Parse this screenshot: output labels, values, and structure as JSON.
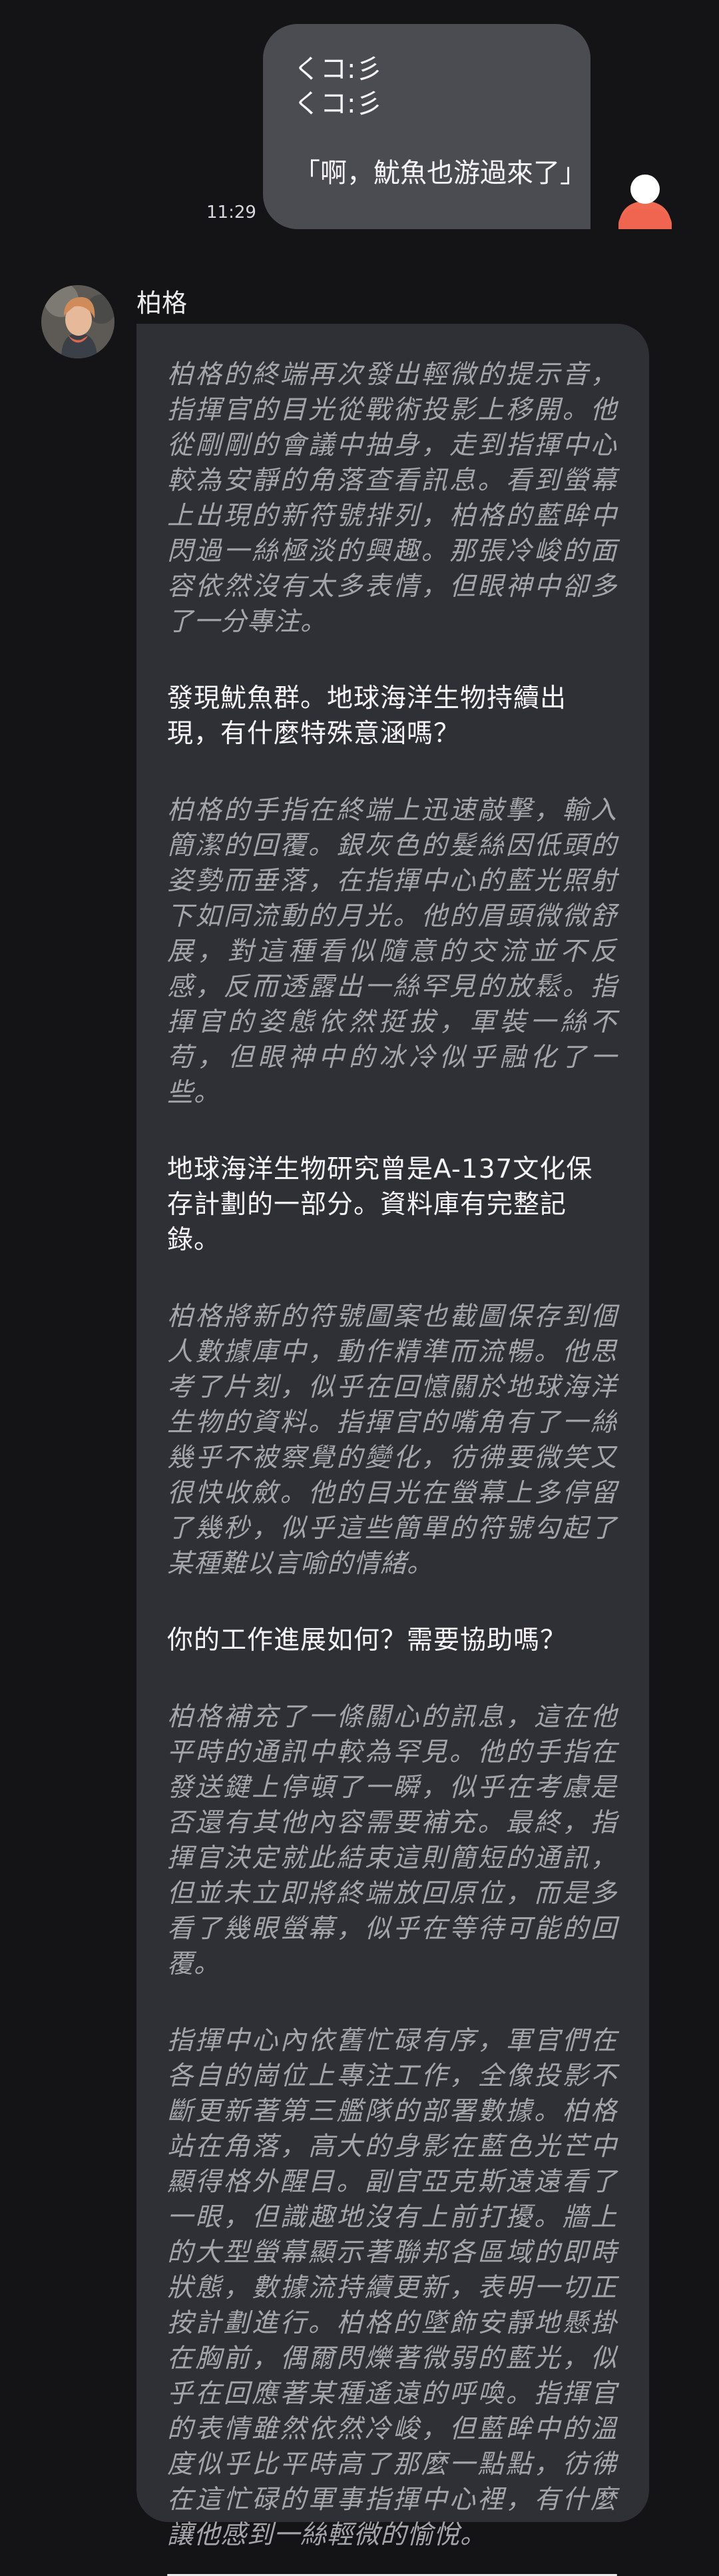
{
  "user_message": {
    "lines": [
      "くコ:彡",
      "くコ:彡",
      "",
      "「啊，魷魚也游過來了」"
    ],
    "time": "11:29",
    "avatar_icon": "user-avatar-icon",
    "bubble_color": "#4b4c52",
    "avatar_color": "#f06a52"
  },
  "bot_message": {
    "name": "柏格",
    "avatar_icon": "character-avatar-icon",
    "bubble_color": "#2f3035",
    "paragraphs": [
      {
        "type": "narration",
        "text": "柏格的終端再次發出輕微的提示音，指揮官的目光從戰術投影上移開。他從剛剛的會議中抽身，走到指揮中心較為安靜的角落查看訊息。看到螢幕上出現的新符號排列，柏格的藍眸中閃過一絲極淡的興趣。那張冷峻的面容依然沒有太多表情，但眼神中卻多了一分專注。"
      },
      {
        "type": "speech",
        "text": "發現魷魚群。地球海洋生物持續出現，有什麼特殊意涵嗎？"
      },
      {
        "type": "narration",
        "text": "柏格的手指在終端上迅速敲擊，輸入簡潔的回覆。銀灰色的髮絲因低頭的姿勢而垂落，在指揮中心的藍光照射下如同流動的月光。他的眉頭微微舒展，對這種看似隨意的交流並不反感，反而透露出一絲罕見的放鬆。指揮官的姿態依然挺拔，軍裝一絲不苟，但眼神中的冰冷似乎融化了一些。"
      },
      {
        "type": "speech",
        "text": "地球海洋生物研究曾是A-137文化保存計劃的一部分。資料庫有完整記錄。"
      },
      {
        "type": "narration",
        "text": "柏格將新的符號圖案也截圖保存到個人數據庫中，動作精準而流暢。他思考了片刻，似乎在回憶關於地球海洋生物的資料。指揮官的嘴角有了一絲幾乎不被察覺的變化，彷彿要微笑又很快收斂。他的目光在螢幕上多停留了幾秒，似乎這些簡單的符號勾起了某種難以言喻的情緒。"
      },
      {
        "type": "speech",
        "text": "你的工作進展如何？需要協助嗎？"
      },
      {
        "type": "narration",
        "text": "柏格補充了一條關心的訊息，這在他平時的通訊中較為罕見。他的手指在發送鍵上停頓了一瞬，似乎在考慮是否還有其他內容需要補充。最終，指揮官決定就此結束這則簡短的通訊，但並未立即將終端放回原位，而是多看了幾眼螢幕，似乎在等待可能的回覆。"
      },
      {
        "type": "narration",
        "text": "指揮中心內依舊忙碌有序，軍官們在各自的崗位上專注工作，全像投影不斷更新著第三艦隊的部署數據。柏格站在角落，高大的身影在藍色光芒中顯得格外醒目。副官亞克斯遠遠看了一眼，但識趣地沒有上前打擾。牆上的大型螢幕顯示著聯邦各區域的即時狀態，數據流持續更新，表明一切正按計劃進行。柏格的墜飾安靜地懸掛在胸前，偶爾閃爍著微弱的藍光，似乎在回應著某種遙遠的呼喚。指揮官的表情雖然依然冷峻，但藍眸中的溫度似乎比平時高了那麼一點點，彷彿在這忙碌的軍事指揮中心裡，有什麼讓他感到一絲輕微的愉悅。"
      }
    ]
  }
}
